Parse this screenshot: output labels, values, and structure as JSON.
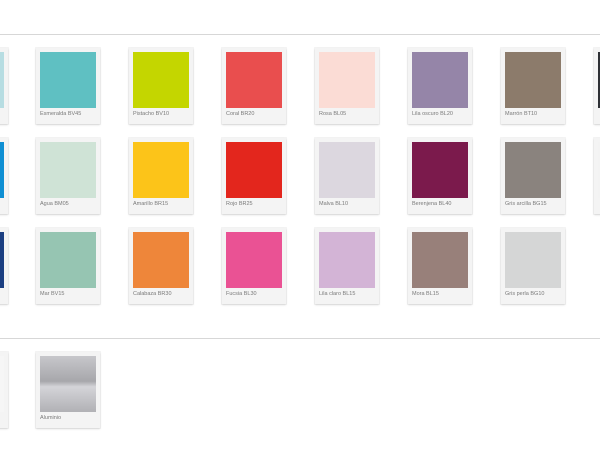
{
  "colors": {
    "divider": "#d7d7d7",
    "card_background": "#f4f4f4",
    "label_text": "#7a7a7a"
  },
  "swatches_top": [
    {
      "name": "partial-cyan",
      "label": "",
      "color": "#b7dde2"
    },
    {
      "name": "esmeralda",
      "label": "Esmeralda BV45",
      "color": "#5fc0c2"
    },
    {
      "name": "pistacho",
      "label": "Pistacho BV10",
      "color": "#c4d600"
    },
    {
      "name": "coral",
      "label": "Coral BR20",
      "color": "#e94e4e"
    },
    {
      "name": "rosa",
      "label": "Rosa BL05",
      "color": "#fbdcd5"
    },
    {
      "name": "lila-oscuro",
      "label": "Lila oscuro BL20",
      "color": "#9585a8"
    },
    {
      "name": "marron",
      "label": "Marrón BT10",
      "color": "#8c7b6b"
    },
    {
      "name": "partial-dark",
      "label": "",
      "color": "#2f3136"
    },
    {
      "name": "partial-blue",
      "label": "",
      "color": "#0f8fd3"
    },
    {
      "name": "agua",
      "label": "Agua BM05",
      "color": "#cfe3d6"
    },
    {
      "name": "amarillo",
      "label": "Amarillo BR15",
      "color": "#fcc419"
    },
    {
      "name": "rojo",
      "label": "Rojo BR25",
      "color": "#e3261d"
    },
    {
      "name": "malva",
      "label": "Malva BL10",
      "color": "#dcd7df"
    },
    {
      "name": "berenjena",
      "label": "Berenjena BL40",
      "color": "#7b1a4c"
    },
    {
      "name": "gris-arcilla",
      "label": "Gris arcilla BG15",
      "color": "#8a837e"
    },
    {
      "name": "partial-light",
      "label": "",
      "color": "#f3f3f3"
    },
    {
      "name": "partial-navy",
      "label": "",
      "color": "#1c3f82"
    },
    {
      "name": "mar",
      "label": "Mar BV15",
      "color": "#96c5b2"
    },
    {
      "name": "calabaza",
      "label": "Calabaza BR30",
      "color": "#ee863a"
    },
    {
      "name": "fucsia",
      "label": "Fucsia BL30",
      "color": "#ea5294"
    },
    {
      "name": "lila-claro",
      "label": "Lila claro BL15",
      "color": "#d3b4d6"
    },
    {
      "name": "mora",
      "label": "Mora BL15",
      "color": "#98807a"
    },
    {
      "name": "gris-perla",
      "label": "Gris perla BG10",
      "color": "#d5d6d6"
    }
  ],
  "swatches_bottom": [
    {
      "name": "partial-white",
      "label": "",
      "color": "#f6f6f6"
    },
    {
      "name": "aluminio",
      "label": "Aluminio",
      "color": "#b9b9bd"
    }
  ]
}
